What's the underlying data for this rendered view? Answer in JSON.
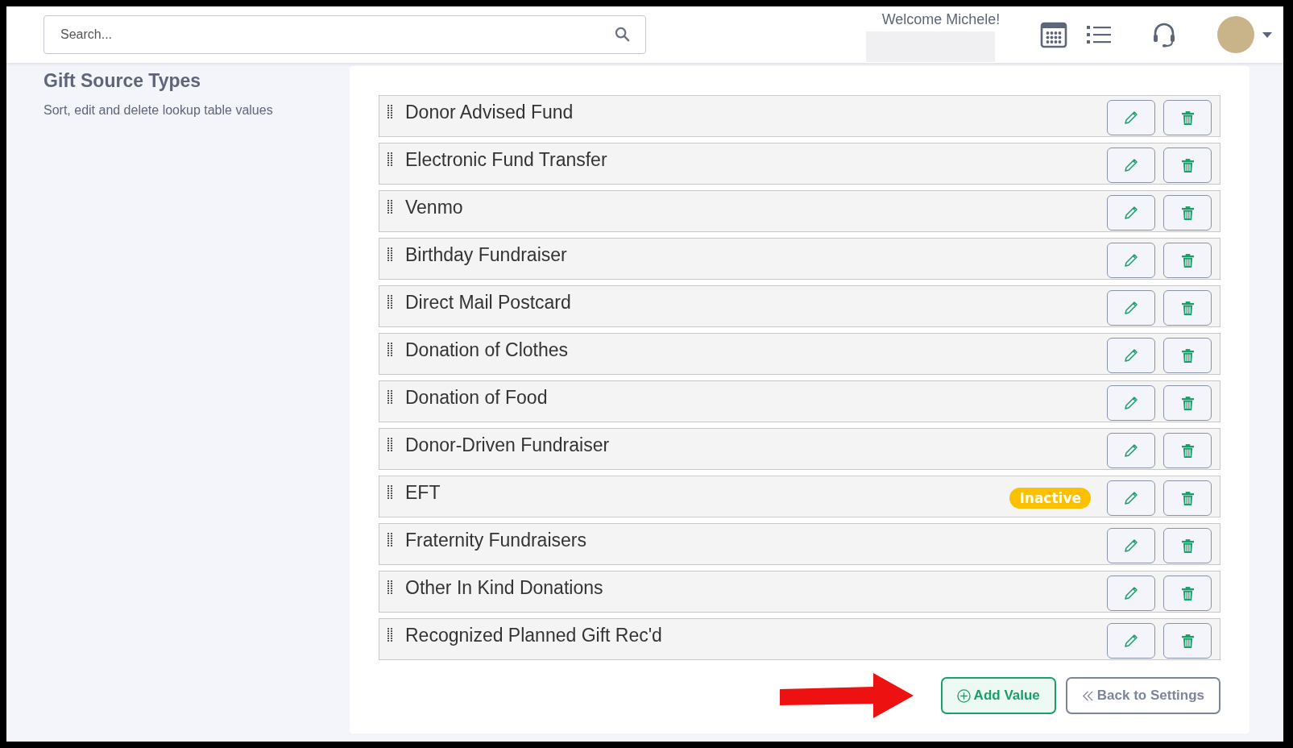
{
  "search": {
    "placeholder": "Search..."
  },
  "header": {
    "welcome": "Welcome Michele!"
  },
  "page": {
    "title": "Gift Source Types",
    "subtitle": "Sort, edit and delete lookup table values"
  },
  "items": [
    {
      "label": "Donor Advised Fund",
      "inactive": false
    },
    {
      "label": "Electronic Fund Transfer",
      "inactive": false
    },
    {
      "label": "Venmo",
      "inactive": false
    },
    {
      "label": "Birthday Fundraiser",
      "inactive": false
    },
    {
      "label": "Direct Mail Postcard",
      "inactive": false
    },
    {
      "label": "Donation of Clothes",
      "inactive": false
    },
    {
      "label": "Donation of Food",
      "inactive": false
    },
    {
      "label": "Donor-Driven Fundraiser",
      "inactive": false
    },
    {
      "label": "EFT",
      "inactive": true,
      "badge": "Inactive"
    },
    {
      "label": "Fraternity Fundraisers",
      "inactive": false
    },
    {
      "label": "Other In Kind Donations",
      "inactive": false
    },
    {
      "label": "Recognized Planned Gift Rec'd",
      "inactive": false
    }
  ],
  "actions": {
    "add": "Add Value",
    "back": "Back to Settings"
  }
}
